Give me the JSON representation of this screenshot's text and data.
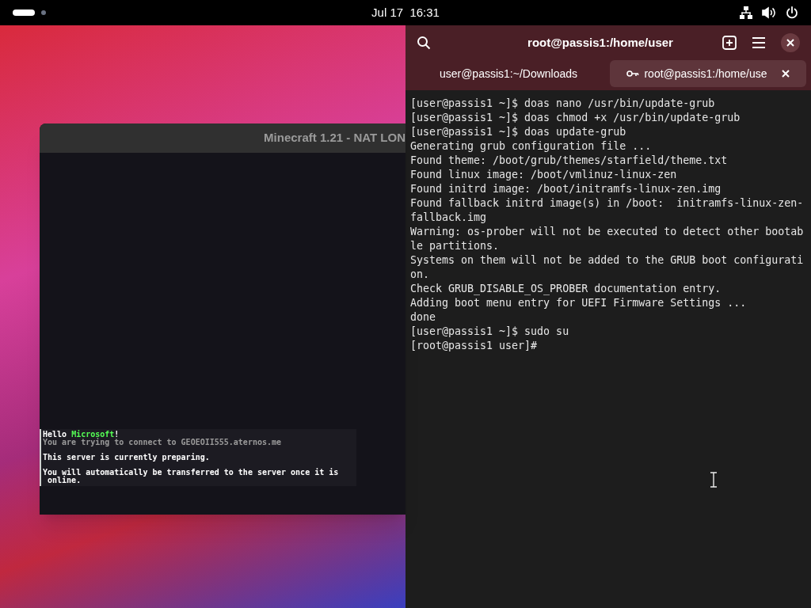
{
  "top_bar": {
    "clock": "Jul 17  16:31"
  },
  "game_window": {
    "title": "Minecraft 1.21 - NAT LON",
    "chat": [
      {
        "segments": [
          {
            "text": "Hello "
          },
          {
            "text": "Microsoft",
            "color": "#55ff55"
          },
          {
            "text": "!"
          }
        ]
      },
      {
        "segments": [
          {
            "text": "You are trying to connect to GEOEOII555.aternos.me",
            "color": "#9a9a9a"
          }
        ]
      },
      {
        "segments": [
          {
            "text": "This server is currently preparing."
          }
        ]
      },
      {
        "segments": [
          {
            "text": "You will automatically be transferred to the server once it is"
          }
        ]
      },
      {
        "segments": [
          {
            "text": " online."
          }
        ]
      }
    ]
  },
  "terminal": {
    "title": "root@passis1:/home/user",
    "tabs": [
      {
        "label": "user@passis1:~/Downloads",
        "selected": false,
        "root": false
      },
      {
        "label": "root@passis1:/home/use",
        "selected": true,
        "root": true
      }
    ],
    "lines": [
      "[user@passis1 ~]$ doas nano /usr/bin/update-grub",
      "[user@passis1 ~]$ doas chmod +x /usr/bin/update-grub",
      "[user@passis1 ~]$ doas update-grub",
      "Generating grub configuration file ...",
      "Found theme: /boot/grub/themes/starfield/theme.txt",
      "Found linux image: /boot/vmlinuz-linux-zen",
      "Found initrd image: /boot/initramfs-linux-zen.img",
      "Found fallback initrd image(s) in /boot:  initramfs-linux-zen-",
      "fallback.img",
      "Warning: os-prober will not be executed to detect other bootab",
      "le partitions.",
      "Systems on them will not be added to the GRUB boot configurati",
      "on.",
      "Check GRUB_DISABLE_OS_PROBER documentation entry.",
      "Adding boot menu entry for UEFI Firmware Settings ...",
      "done",
      "[user@passis1 ~]$ sudo su",
      "[root@passis1 user]#"
    ]
  }
}
